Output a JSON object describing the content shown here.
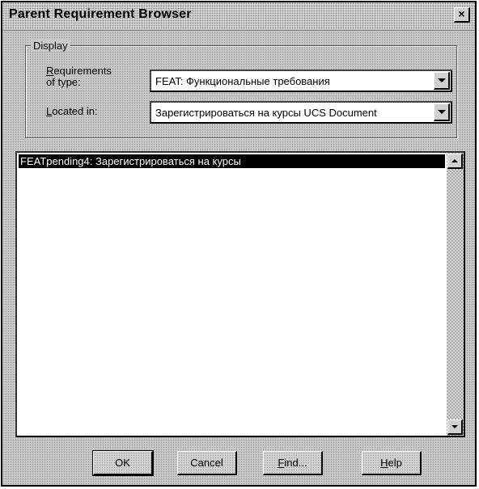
{
  "window": {
    "title": "Parent Requirement Browser",
    "close_glyph": "×"
  },
  "display_group": {
    "legend": "Display",
    "requirements_label_line1_mnemonic": "R",
    "requirements_label_line1_rest": "equirements",
    "requirements_label_line2": "of type:",
    "located_label_mnemonic": "L",
    "located_label_rest": "ocated in:",
    "requirements_type_value": "FEAT: Функциональные требования",
    "located_in_value": "Зарегистрироваться на курсы UCS Document"
  },
  "list": {
    "items": [
      {
        "label": "FEATpending4: Зарегистрироваться на курсы",
        "selected": true
      }
    ]
  },
  "buttons": {
    "ok": "OK",
    "cancel": "Cancel",
    "find_mnemonic": "F",
    "find_rest": "ind...",
    "help_mnemonic": "H",
    "help_rest": "elp"
  },
  "icons": {
    "close": "close-icon",
    "dropdown": "chevron-down-icon",
    "scroll_up": "scroll-up-arrow-icon",
    "scroll_down": "scroll-down-arrow-icon"
  }
}
